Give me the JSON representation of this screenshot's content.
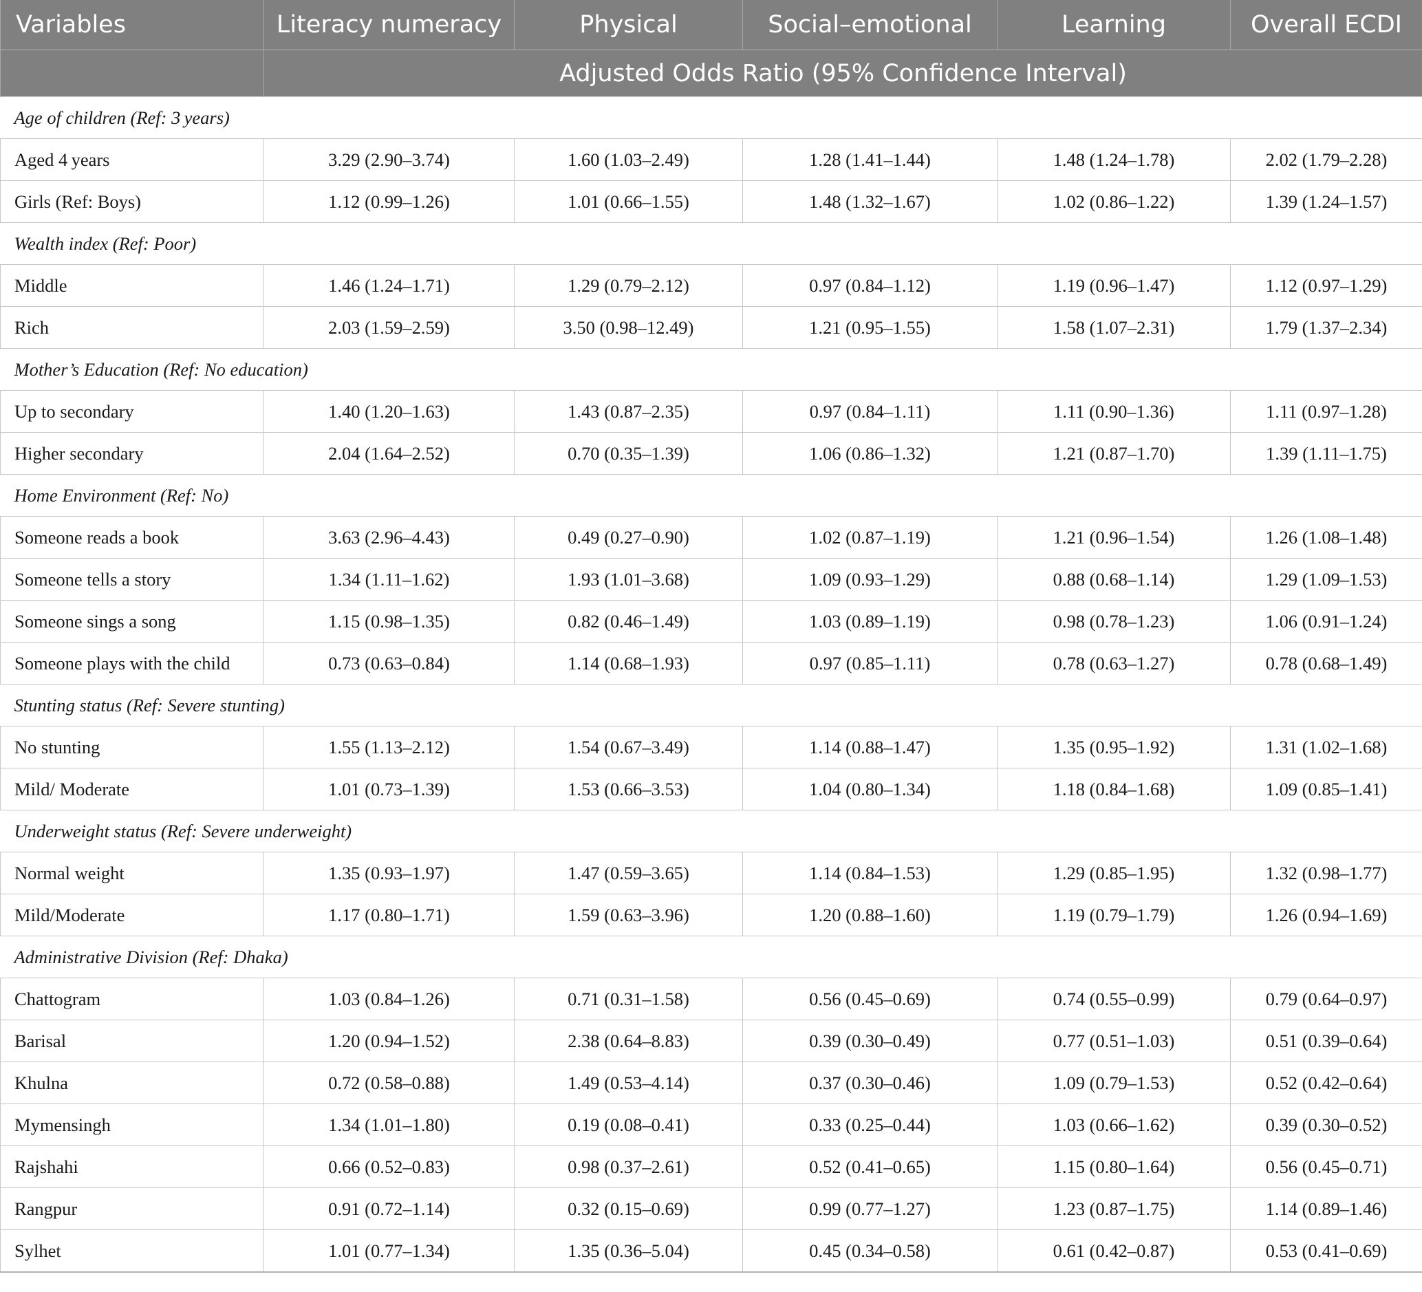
{
  "header": {
    "columns": [
      "Variables",
      "Literacy numeracy",
      "Physical",
      "Social–emotional",
      "Learning",
      "Overall ECDI"
    ],
    "subheader": "Adjusted Odds Ratio (95% Confidence Interval)"
  },
  "rows": [
    {
      "type": "section",
      "label": "Age of children (Ref: 3 years)"
    },
    {
      "type": "data",
      "label": "Aged 4 years",
      "values": [
        "3.29 (2.90–3.74)",
        "1.60 (1.03–2.49)",
        "1.28 (1.41–1.44)",
        "1.48 (1.24–1.78)",
        "2.02 (1.79–2.28)"
      ]
    },
    {
      "type": "data",
      "label": "Girls (Ref: Boys)",
      "values": [
        "1.12 (0.99–1.26)",
        "1.01 (0.66–1.55)",
        "1.48 (1.32–1.67)",
        "1.02 (0.86–1.22)",
        "1.39 (1.24–1.57)"
      ]
    },
    {
      "type": "section",
      "label": "Wealth index (Ref: Poor)"
    },
    {
      "type": "data",
      "label": "Middle",
      "values": [
        "1.46 (1.24–1.71)",
        "1.29 (0.79–2.12)",
        "0.97 (0.84–1.12)",
        "1.19 (0.96–1.47)",
        "1.12 (0.97–1.29)"
      ]
    },
    {
      "type": "data",
      "label": "Rich",
      "values": [
        "2.03 (1.59–2.59)",
        "3.50 (0.98–12.49)",
        "1.21 (0.95–1.55)",
        "1.58 (1.07–2.31)",
        "1.79 (1.37–2.34)"
      ]
    },
    {
      "type": "section",
      "label": "Mother’s Education (Ref: No education)"
    },
    {
      "type": "data",
      "label": "Up to secondary",
      "values": [
        "1.40 (1.20–1.63)",
        "1.43 (0.87–2.35)",
        "0.97 (0.84–1.11)",
        "1.11 (0.90–1.36)",
        "1.11 (0.97–1.28)"
      ]
    },
    {
      "type": "data",
      "label": "Higher secondary",
      "values": [
        "2.04 (1.64–2.52)",
        "0.70 (0.35–1.39)",
        "1.06 (0.86–1.32)",
        "1.21 (0.87–1.70)",
        "1.39 (1.11–1.75)"
      ]
    },
    {
      "type": "section",
      "label": "Home Environment (Ref: No)"
    },
    {
      "type": "data",
      "label": "Someone reads a book",
      "values": [
        "3.63 (2.96–4.43)",
        "0.49 (0.27–0.90)",
        "1.02 (0.87–1.19)",
        "1.21 (0.96–1.54)",
        "1.26 (1.08–1.48)"
      ]
    },
    {
      "type": "data",
      "label": "Someone tells a story",
      "values": [
        "1.34 (1.11–1.62)",
        "1.93 (1.01–3.68)",
        "1.09 (0.93–1.29)",
        "0.88 (0.68–1.14)",
        "1.29 (1.09–1.53)"
      ]
    },
    {
      "type": "data",
      "label": "Someone sings a song",
      "values": [
        "1.15 (0.98–1.35)",
        "0.82 (0.46–1.49)",
        "1.03 (0.89–1.19)",
        "0.98 (0.78–1.23)",
        "1.06 (0.91–1.24)"
      ]
    },
    {
      "type": "data",
      "label": "Someone plays with the child",
      "values": [
        "0.73 (0.63–0.84)",
        "1.14 (0.68–1.93)",
        "0.97 (0.85–1.11)",
        "0.78 (0.63–1.27)",
        "0.78 (0.68–1.49)"
      ]
    },
    {
      "type": "section",
      "label": "Stunting status (Ref: Severe stunting)"
    },
    {
      "type": "data",
      "label": "No stunting",
      "values": [
        "1.55 (1.13–2.12)",
        "1.54 (0.67–3.49)",
        "1.14 (0.88–1.47)",
        "1.35 (0.95–1.92)",
        "1.31 (1.02–1.68)"
      ]
    },
    {
      "type": "data",
      "label": "Mild/ Moderate",
      "values": [
        "1.01 (0.73–1.39)",
        "1.53 (0.66–3.53)",
        "1.04 (0.80–1.34)",
        "1.18 (0.84–1.68)",
        "1.09 (0.85–1.41)"
      ]
    },
    {
      "type": "section",
      "label": "Underweight status (Ref: Severe underweight)"
    },
    {
      "type": "data",
      "label": "Normal weight",
      "values": [
        "1.35 (0.93–1.97)",
        "1.47 (0.59–3.65)",
        "1.14 (0.84–1.53)",
        "1.29 (0.85–1.95)",
        "1.32 (0.98–1.77)"
      ]
    },
    {
      "type": "data",
      "label": "Mild/Moderate",
      "values": [
        "1.17 (0.80–1.71)",
        "1.59 (0.63–3.96)",
        "1.20 (0.88–1.60)",
        "1.19 (0.79–1.79)",
        "1.26 (0.94–1.69)"
      ]
    },
    {
      "type": "section",
      "label": "Administrative Division (Ref: Dhaka)"
    },
    {
      "type": "data",
      "label": "Chattogram",
      "values": [
        "1.03 (0.84–1.26)",
        "0.71 (0.31–1.58)",
        "0.56 (0.45–0.69)",
        "0.74 (0.55–0.99)",
        "0.79 (0.64–0.97)"
      ]
    },
    {
      "type": "data",
      "label": "Barisal",
      "values": [
        "1.20 (0.94–1.52)",
        "2.38 (0.64–8.83)",
        "0.39 (0.30–0.49)",
        "0.77 (0.51–1.03)",
        "0.51 (0.39–0.64)"
      ]
    },
    {
      "type": "data",
      "label": "Khulna",
      "values": [
        "0.72 (0.58–0.88)",
        "1.49 (0.53–4.14)",
        "0.37 (0.30–0.46)",
        "1.09 (0.79–1.53)",
        "0.52 (0.42–0.64)"
      ]
    },
    {
      "type": "data",
      "label": "Mymensingh",
      "values": [
        "1.34 (1.01–1.80)",
        "0.19 (0.08–0.41)",
        "0.33 (0.25–0.44)",
        "1.03 (0.66–1.62)",
        "0.39 (0.30–0.52)"
      ]
    },
    {
      "type": "data",
      "label": "Rajshahi",
      "values": [
        "0.66 (0.52–0.83)",
        "0.98 (0.37–2.61)",
        "0.52 (0.41–0.65)",
        "1.15 (0.80–1.64)",
        "0.56 (0.45–0.71)"
      ]
    },
    {
      "type": "data",
      "label": "Rangpur",
      "values": [
        "0.91 (0.72–1.14)",
        "0.32 (0.15–0.69)",
        "0.99 (0.77–1.27)",
        "1.23 (0.87–1.75)",
        "1.14 (0.89–1.46)"
      ]
    },
    {
      "type": "data",
      "label": "Sylhet",
      "values": [
        "1.01 (0.77–1.34)",
        "1.35 (0.36–5.04)",
        "0.45 (0.34–0.58)",
        "0.61 (0.42–0.87)",
        "0.53 (0.41–0.69)"
      ]
    }
  ]
}
